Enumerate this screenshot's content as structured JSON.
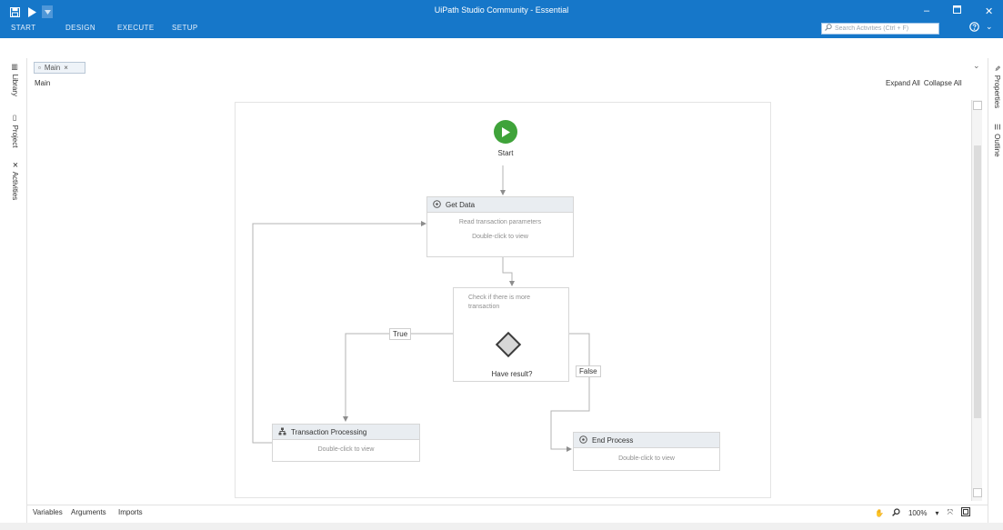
{
  "app": {
    "title": "UiPath Studio Community - Essential",
    "ribbon_tabs": [
      "START",
      "DESIGN",
      "EXECUTE",
      "SETUP"
    ],
    "search_placeholder": "Search Activities (Ctrl + F)"
  },
  "left_panels": [
    "Library",
    "Project",
    "Activities"
  ],
  "right_panels": [
    "Properties",
    "Outline"
  ],
  "document_tab": {
    "label": "Main"
  },
  "designer": {
    "breadcrumb": "Main",
    "expand_all": "Expand All",
    "collapse_all": "Collapse All"
  },
  "flowchart": {
    "start": {
      "label": "Start"
    },
    "nodes": {
      "get_data": {
        "title": "Get Data",
        "description": "Read transaction parameters",
        "hint": "Double-click to view"
      },
      "transaction_processing": {
        "title": "Transaction Processing",
        "hint": "Double-click to view"
      },
      "end_process": {
        "title": "End Process",
        "hint": "Double-click to view"
      }
    },
    "decision": {
      "condition": "Check if there is more transaction",
      "label": "Have result?"
    },
    "edge_labels": {
      "true": "True",
      "false": "False"
    }
  },
  "bottom_bar": {
    "tabs": [
      "Variables",
      "Arguments",
      "Imports"
    ],
    "zoom": "100%"
  },
  "colors": {
    "ribbon": "#1677c9",
    "start_node": "#3fa33a"
  }
}
